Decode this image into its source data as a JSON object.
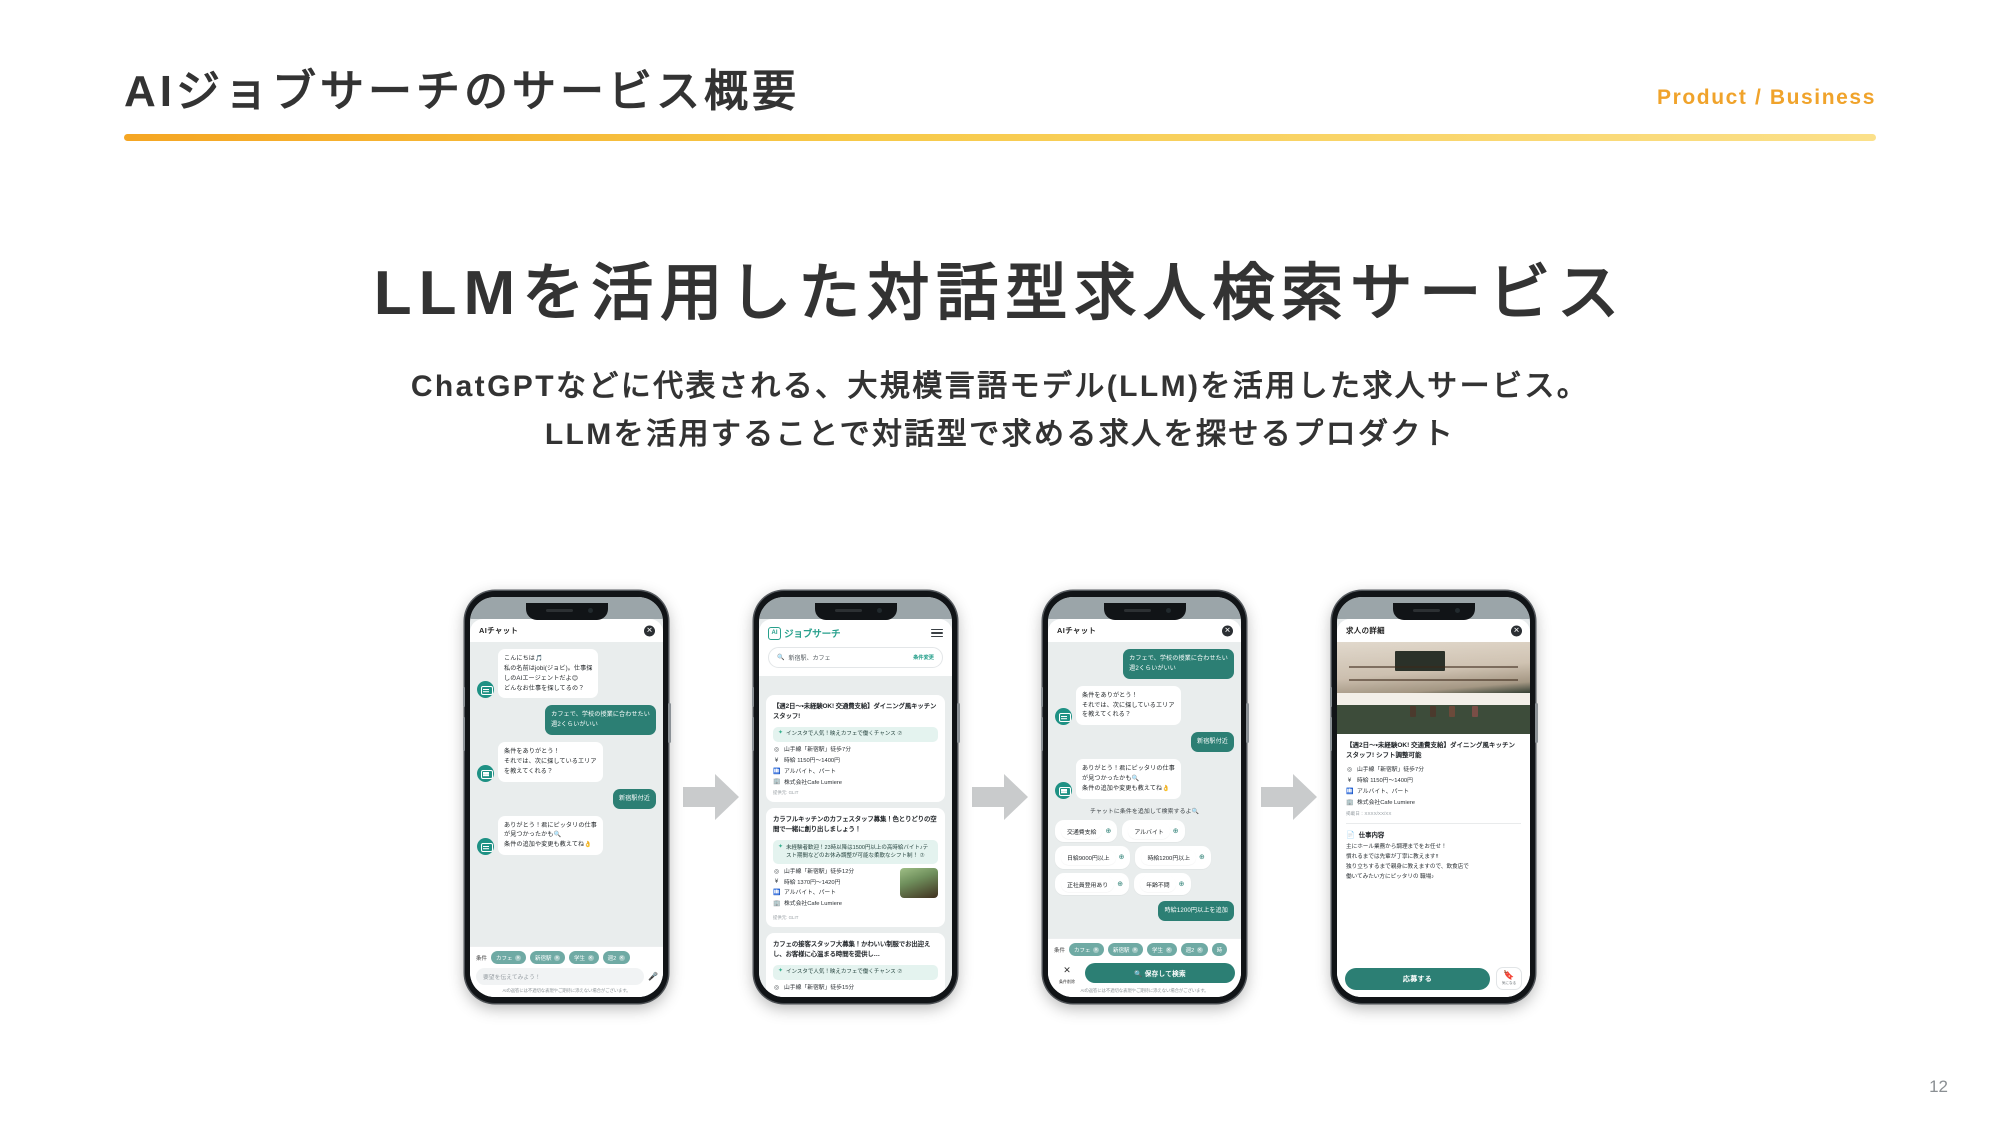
{
  "header": {
    "title": "AIジョブサーチのサービス概要",
    "tag": "Product / Business",
    "accent": "#F0A32B"
  },
  "hero": {
    "heading": "LLMを活用した対話型求人検索サービス",
    "sub_line1": "ChatGPTなどに代表される、大規模言語モデル(LLM)を活用した求人サービス。",
    "sub_line2": "LLMを活用することで対話型で求める求人を探せるプロダクト"
  },
  "arrow_icon": "arrow-right-icon",
  "page_number": "12",
  "phones": [
    {
      "id": "phone-chat-intro",
      "app_bar": {
        "title": "AIチャット",
        "close": "✕"
      },
      "messages": [
        {
          "role": "bot",
          "text": "こんにちは🎵\n私の名前はjobi(ジョビ)。仕事探\nしのAIエージェントだよ😊\nどんなお仕事を探してるの？"
        },
        {
          "role": "me",
          "text": "カフェで、学校の授業に合わせたい\n週2くらいがいい"
        },
        {
          "role": "bot",
          "text": "条件をありがとう！\nそれでは、次に探しているエリア\nを教えてくれる？"
        },
        {
          "role": "me",
          "text": "新宿駅付近"
        },
        {
          "role": "bot",
          "text": "ありがとう！君にピッタリの仕事\nが見つかったかも🔍\n条件の追加や変更も教えてね👌"
        }
      ],
      "conditions_label": "条件",
      "chips": [
        "カフェ",
        "新宿駅",
        "学生",
        "週2"
      ],
      "input_placeholder": "要望を伝えてみよう！",
      "mic_icon": "microphone-icon",
      "disclaimer": "AIの返答には不適切な表現やご期待に添えない場合がございます。"
    },
    {
      "id": "phone-job-list",
      "brand": {
        "mark": "AI",
        "wordmark": "ジョブサーチ"
      },
      "menu_icon": "hamburger-menu-icon",
      "search": {
        "icon": "search-icon",
        "query": "新宿駅、カフェ",
        "change_label": "条件変更"
      },
      "jobs": [
        {
          "title": "【週2日〜・未経験OK! 交通費支給】ダイニング風キッチンスタッフ!",
          "badge": "インスタで人気！映えカフェで働くチャンス ⑦",
          "station": "山手線「新宿駅」徒歩7分",
          "wage": "時給 1150円〜1400円",
          "type": "アルバイト、パート",
          "company": "株式会社Cafe Lumiere",
          "source": "提供元: GLIT",
          "has_thumb": false
        },
        {
          "title": "カラフルキッチンのカフェスタッフ募集！色とりどりの空間で一緒に創り出しましょう！",
          "badge": "未経験者歓迎！23時以降は1500円以上の高時給バイト♪テスト期間などのお休み調整が可能な柔軟なシフト制！ ⑦",
          "station": "山手線「新宿駅」徒歩12分",
          "wage": "時給 1370円〜1420円",
          "type": "アルバイト、パート",
          "company": "株式会社Cafe Lumiere",
          "source": "提供元: GLIT",
          "has_thumb": true
        },
        {
          "title": "カフェの接客スタッフ大募集！かわいい制服でお出迎えし、お客様に心温まる時間を提供し…",
          "badge": "インスタで人気！映えカフェで働くチャンス ⑦",
          "station": "山手線「新宿駅」徒歩15分",
          "wage": "",
          "type": "",
          "company": "",
          "source": "",
          "has_thumb": false
        }
      ]
    },
    {
      "id": "phone-chat-refine",
      "app_bar": {
        "title": "AIチャット",
        "close": "✕"
      },
      "messages": [
        {
          "role": "me",
          "text": "カフェで、学校の授業に合わせたい\n週2くらいがいい"
        },
        {
          "role": "bot",
          "text": "条件をありがとう！\nそれでは、次に探しているエリア\nを教えてくれる？"
        },
        {
          "role": "me",
          "text": "新宿駅付近"
        },
        {
          "role": "bot",
          "text": "ありがとう！君にピッタリの仕事\nが見つかったかも🔍\n条件の追加や変更も教えてね👌"
        }
      ],
      "suggest_hint": "チャットに条件を追加して検索するよ🔍",
      "suggestions": [
        "交通費支給",
        "アルバイト",
        "日給9000円以上",
        "時給1200円以上",
        "正社員登用あり",
        "年齢不問"
      ],
      "last_user_msg": "時給1200円以上を追加",
      "conditions_label": "条件",
      "chips": [
        "カフェ",
        "新宿駅",
        "学生",
        "週2",
        "時"
      ],
      "clear_btn": {
        "icon": "✕",
        "label": "条件削除"
      },
      "save_btn": {
        "icon": "search-icon",
        "label": "保存して検索"
      },
      "disclaimer": "AIの返答には不適切な表現やご期待に添えない場合がございます。"
    },
    {
      "id": "phone-job-detail",
      "app_bar": {
        "title": "求人の詳細",
        "close": "✕"
      },
      "hero_image": "cafe-interior-photo",
      "title": "【週2日〜・未経験OK! 交通費支給】ダイニング風キッチンスタッフ! シフト調整可能",
      "station": "山手線「新宿駅」徒歩7分",
      "wage": "時給 1150円〜1400円",
      "type": "アルバイト、パート",
      "company": "株式会社Cafe Lumiere",
      "posted": "掲載日：XXXX/XX/XX",
      "section_title": "仕事内容",
      "section_icon": "document-icon",
      "body": "主にホール業務から調理までをお任せ！\n慣れるまでは先輩が丁寧に教えます!!\n独り立ちするまで親身に教えますので、飲食店で\n働いてみたい方にピッタリの 職場♪",
      "apply_label": "応募する",
      "fav": {
        "icon": "bookmark-icon",
        "label": "気になる"
      }
    }
  ]
}
